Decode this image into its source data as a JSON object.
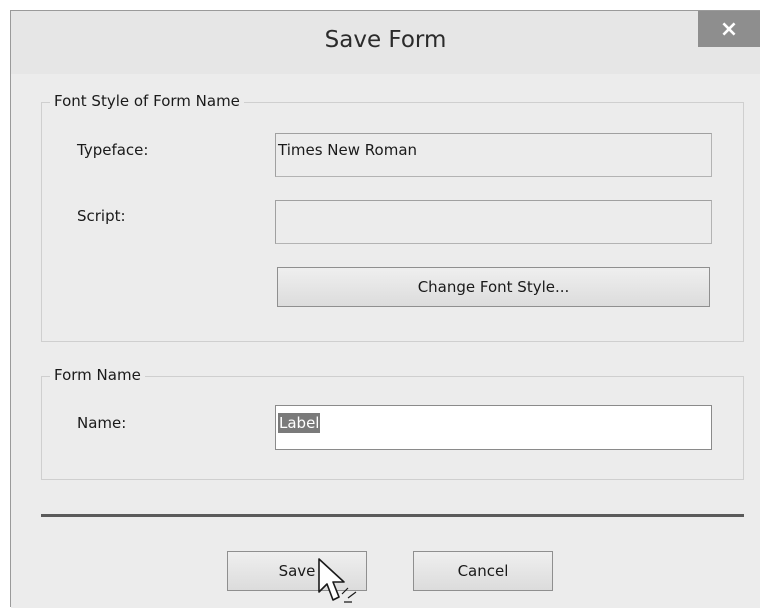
{
  "window": {
    "title": "Save Form",
    "close_label": "×"
  },
  "font_group": {
    "legend": "Font Style of Form Name",
    "typeface_label": "Typeface:",
    "typeface_value": "Times New Roman",
    "script_label": "Script:",
    "script_value": "",
    "change_font_button": "Change Font Style..."
  },
  "name_group": {
    "legend": "Form Name",
    "name_label": "Name:",
    "name_value": "Label"
  },
  "buttons": {
    "save": "Save",
    "cancel": "Cancel"
  }
}
